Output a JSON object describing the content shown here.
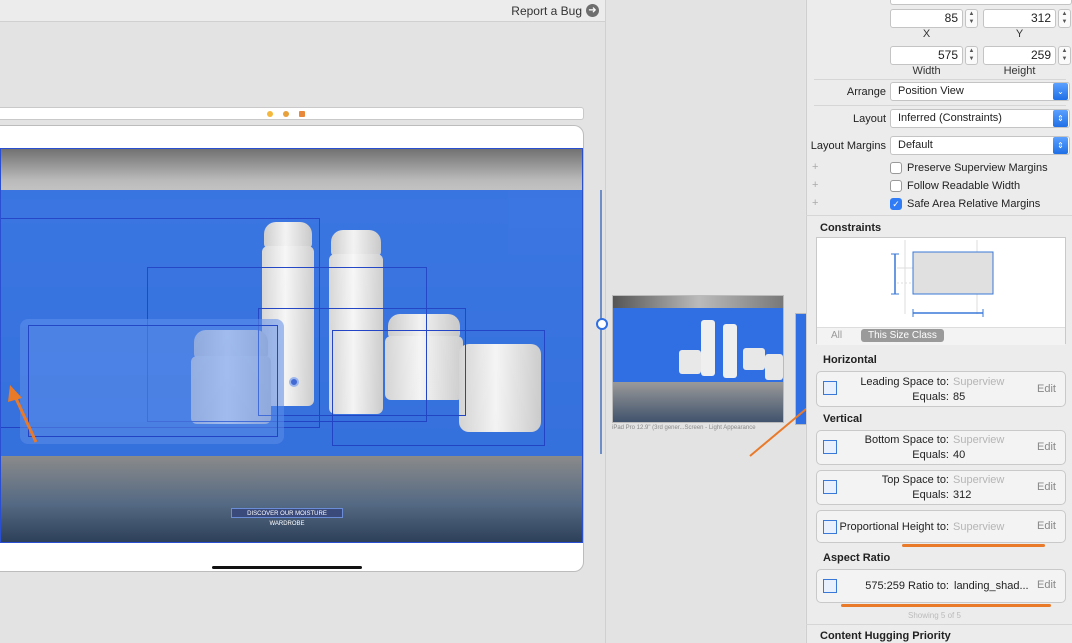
{
  "toolbar": {
    "report_bug": "Report a Bug"
  },
  "canvas": {
    "discover_label": "DISCOVER OUR MOISTURE WARDROBE",
    "thumbnail_caption": "iPad Pro 12.9\" (3rd gener...Screen - Light Appearance"
  },
  "inspector": {
    "x_value": "85",
    "y_value": "312",
    "x_label": "X",
    "y_label": "Y",
    "width_value": "575",
    "height_value": "259",
    "width_label": "Width",
    "height_label": "Height",
    "arrange_label": "Arrange",
    "arrange_value": "Position View",
    "layout_label": "Layout",
    "layout_value": "Inferred (Constraints)",
    "margins_label": "Layout Margins",
    "margins_value": "Default",
    "check_preserve": "Preserve Superview Margins",
    "check_readable": "Follow Readable Width",
    "check_safe": "Safe Area Relative Margins",
    "constraints_title": "Constraints",
    "tab_all": "All",
    "tab_size_class": "This Size Class",
    "horizontal_title": "Horizontal",
    "vertical_title": "Vertical",
    "aspect_title": "Aspect Ratio",
    "hugging_title": "Content Hugging Priority",
    "showing": "Showing 5 of 5",
    "edit": "Edit",
    "leading": {
      "label": "Leading Space to:",
      "target": "Superview",
      "equals_label": "Equals:",
      "equals": "85"
    },
    "bottom": {
      "label": "Bottom Space to:",
      "target": "Superview",
      "equals_label": "Equals:",
      "equals": "40"
    },
    "top": {
      "label": "Top Space to:",
      "target": "Superview",
      "equals_label": "Equals:",
      "equals": "312"
    },
    "proportional": {
      "label": "Proportional Height to:",
      "target": "Superview"
    },
    "ratio": {
      "label": "575:259 Ratio to:",
      "target": "landing_shad..."
    }
  },
  "colors": {
    "accent": "#2f6fe3",
    "annotation": "#e97a2a"
  }
}
